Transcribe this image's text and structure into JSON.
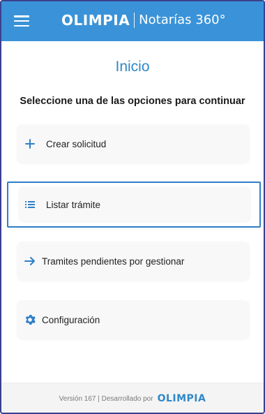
{
  "header": {
    "brand_logo": "OLIMPIA",
    "product_name": "Notarías 360°",
    "background_color": "#3a93d8"
  },
  "main": {
    "title": "Inicio",
    "subtitle": "Seleccione una de las opciones para continuar",
    "options": [
      {
        "label": "Crear solicitud",
        "icon": "plus-icon",
        "selected": false
      },
      {
        "label": "Listar trámite",
        "icon": "list-icon",
        "selected": true
      },
      {
        "label": "Tramites pendientes por gestionar",
        "icon": "arrow-right-icon",
        "selected": false
      },
      {
        "label": "Configuración",
        "icon": "gear-icon",
        "selected": false
      }
    ]
  },
  "footer": {
    "text": "Versión 167 | Desarrollado por",
    "logo": "OLIMPIA"
  },
  "colors": {
    "accent": "#2f88c8",
    "selection_border": "#2f7fc8"
  }
}
